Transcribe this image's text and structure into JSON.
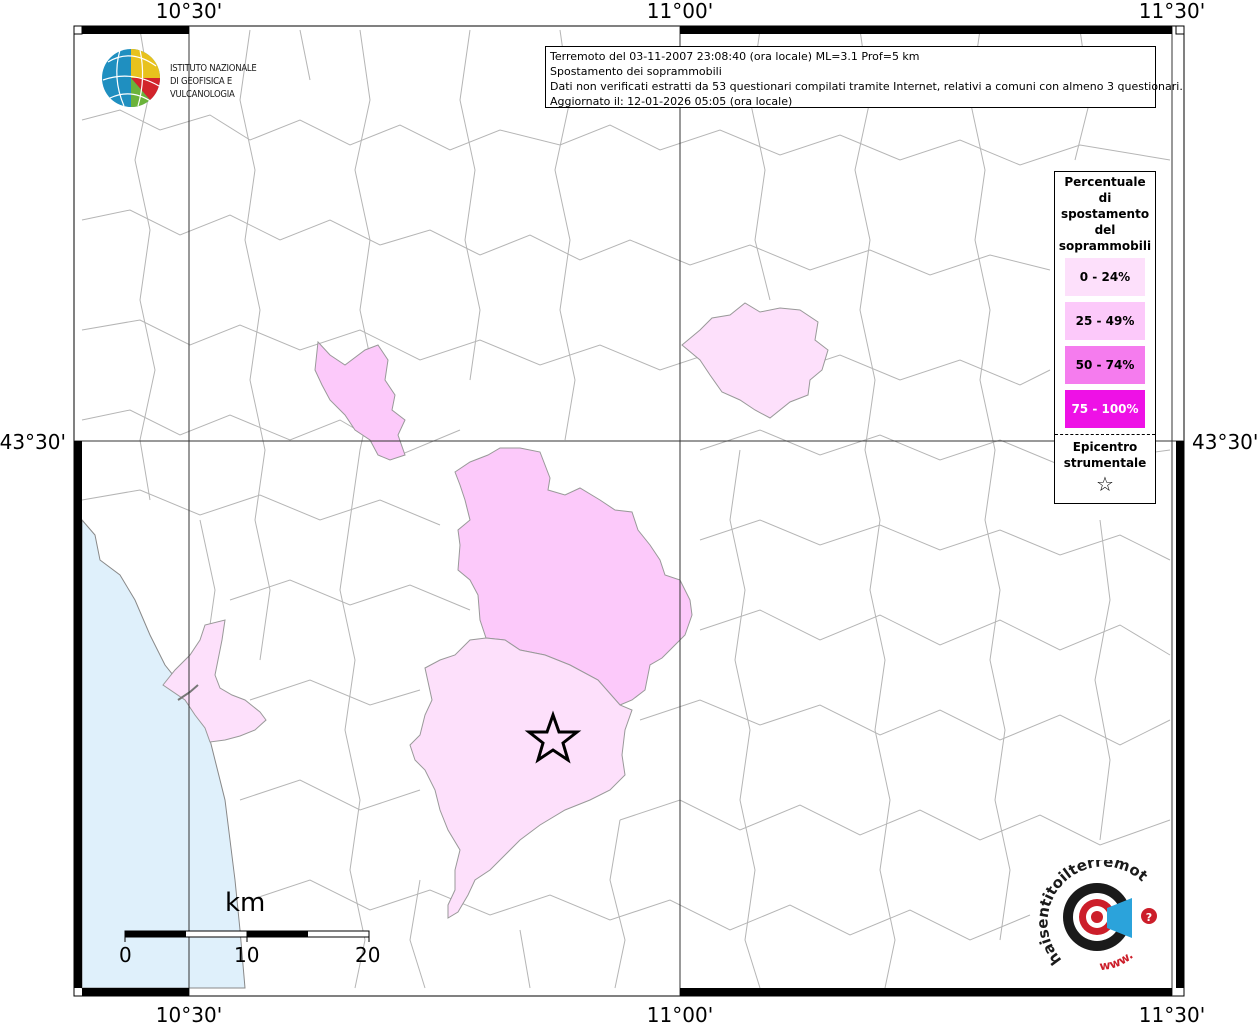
{
  "map": {
    "lon_labels": [
      "10°30'",
      "11°00'",
      "11°30'"
    ],
    "lat_labels": [
      "43°30'",
      "43°30'"
    ]
  },
  "info_box": {
    "line1": "Terremoto del 03-11-2007 23:08:40 (ora locale) ML=3.1 Prof=5 km",
    "line2": "Spostamento dei soprammobili",
    "line3": "Dati non verificati estratti da 53 questionari compilati tramite Internet, relativi a comuni con almeno 3 questionari.",
    "line4": "Aggiornato il: 12-01-2026 05:05 (ora locale)"
  },
  "logo": {
    "line1": "ISTITUTO NAZIONALE",
    "line2": "DI GEOFISICA E VULCANOLOGIA"
  },
  "legend": {
    "title_lines": [
      "Percentuale",
      "di",
      "spostamento",
      "del",
      "soprammobili"
    ],
    "items": [
      {
        "label": "0 - 24%",
        "color": "#fde0fb",
        "text_color": "#000000"
      },
      {
        "label": "25 - 49%",
        "color": "#fcc9fa",
        "text_color": "#000000"
      },
      {
        "label": "50 - 74%",
        "color": "#f57cee",
        "text_color": "#000000"
      },
      {
        "label": "75 - 100%",
        "color": "#ee11e6",
        "text_color": "#ffffff"
      }
    ],
    "epicenter_line1": "Epicentro",
    "epicenter_line2": "strumentale",
    "epicenter_symbol": "☆"
  },
  "scale_bar": {
    "unit": "km",
    "ticks": [
      "0",
      "10",
      "20"
    ]
  },
  "watermark": {
    "text": "haisentitoilterremoto.it",
    "url_text": "www."
  },
  "colors": {
    "sea": "#dff0fb",
    "border": "#b0b0b0",
    "pct_0_24": "#fde0fb",
    "pct_25_49": "#fcc9fa"
  }
}
